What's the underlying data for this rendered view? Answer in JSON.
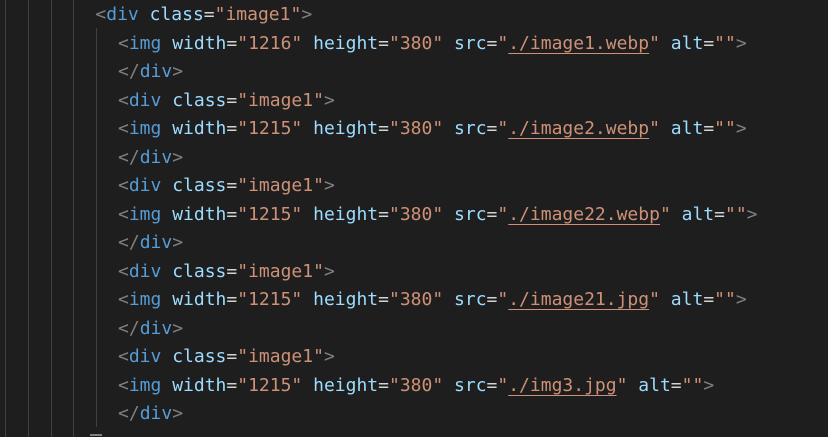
{
  "editor": {
    "lines": [
      {
        "indent": 4,
        "tokens": [
          {
            "t": "<",
            "c": "bracket"
          },
          {
            "t": "div",
            "c": "tag"
          },
          {
            "t": " "
          },
          {
            "t": "class",
            "c": "attr"
          },
          {
            "t": "=",
            "c": "eq"
          },
          {
            "t": "\"image1\"",
            "c": "str"
          },
          {
            "t": ">",
            "c": "bracket"
          }
        ]
      },
      {
        "indent": 5,
        "tokens": [
          {
            "t": "<",
            "c": "bracket"
          },
          {
            "t": "img",
            "c": "tag"
          },
          {
            "t": " "
          },
          {
            "t": "width",
            "c": "attr"
          },
          {
            "t": "=",
            "c": "eq"
          },
          {
            "t": "\"1216\"",
            "c": "str"
          },
          {
            "t": " "
          },
          {
            "t": "height",
            "c": "attr"
          },
          {
            "t": "=",
            "c": "eq"
          },
          {
            "t": "\"380\"",
            "c": "str"
          },
          {
            "t": " "
          },
          {
            "t": "src",
            "c": "attr"
          },
          {
            "t": "=",
            "c": "eq"
          },
          {
            "t": "\"",
            "c": "str"
          },
          {
            "t": "./image1.webp",
            "c": "link"
          },
          {
            "t": "\"",
            "c": "str"
          },
          {
            "t": " "
          },
          {
            "t": "alt",
            "c": "attr"
          },
          {
            "t": "=",
            "c": "eq"
          },
          {
            "t": "\"\"",
            "c": "str"
          },
          {
            "t": ">",
            "c": "bracket"
          }
        ]
      },
      {
        "indent": 5,
        "tokens": [
          {
            "t": "</",
            "c": "bracket"
          },
          {
            "t": "div",
            "c": "tag"
          },
          {
            "t": ">",
            "c": "bracket"
          }
        ]
      },
      {
        "indent": 5,
        "tokens": [
          {
            "t": "<",
            "c": "bracket"
          },
          {
            "t": "div",
            "c": "tag"
          },
          {
            "t": " "
          },
          {
            "t": "class",
            "c": "attr"
          },
          {
            "t": "=",
            "c": "eq"
          },
          {
            "t": "\"image1\"",
            "c": "str"
          },
          {
            "t": ">",
            "c": "bracket"
          }
        ]
      },
      {
        "indent": 5,
        "tokens": [
          {
            "t": "<",
            "c": "bracket"
          },
          {
            "t": "img",
            "c": "tag"
          },
          {
            "t": " "
          },
          {
            "t": "width",
            "c": "attr"
          },
          {
            "t": "=",
            "c": "eq"
          },
          {
            "t": "\"1215\"",
            "c": "str"
          },
          {
            "t": " "
          },
          {
            "t": "height",
            "c": "attr"
          },
          {
            "t": "=",
            "c": "eq"
          },
          {
            "t": "\"380\"",
            "c": "str"
          },
          {
            "t": " "
          },
          {
            "t": "src",
            "c": "attr"
          },
          {
            "t": "=",
            "c": "eq"
          },
          {
            "t": "\"",
            "c": "str"
          },
          {
            "t": "./image2.webp",
            "c": "link"
          },
          {
            "t": "\"",
            "c": "str"
          },
          {
            "t": " "
          },
          {
            "t": "alt",
            "c": "attr"
          },
          {
            "t": "=",
            "c": "eq"
          },
          {
            "t": "\"\"",
            "c": "str"
          },
          {
            "t": ">",
            "c": "bracket"
          }
        ]
      },
      {
        "indent": 5,
        "tokens": [
          {
            "t": "</",
            "c": "bracket"
          },
          {
            "t": "div",
            "c": "tag"
          },
          {
            "t": ">",
            "c": "bracket"
          }
        ]
      },
      {
        "indent": 5,
        "tokens": [
          {
            "t": "<",
            "c": "bracket"
          },
          {
            "t": "div",
            "c": "tag"
          },
          {
            "t": " "
          },
          {
            "t": "class",
            "c": "attr"
          },
          {
            "t": "=",
            "c": "eq"
          },
          {
            "t": "\"image1\"",
            "c": "str"
          },
          {
            "t": ">",
            "c": "bracket"
          }
        ]
      },
      {
        "indent": 5,
        "tokens": [
          {
            "t": "<",
            "c": "bracket"
          },
          {
            "t": "img",
            "c": "tag"
          },
          {
            "t": " "
          },
          {
            "t": "width",
            "c": "attr"
          },
          {
            "t": "=",
            "c": "eq"
          },
          {
            "t": "\"1215\"",
            "c": "str"
          },
          {
            "t": " "
          },
          {
            "t": "height",
            "c": "attr"
          },
          {
            "t": "=",
            "c": "eq"
          },
          {
            "t": "\"380\"",
            "c": "str"
          },
          {
            "t": " "
          },
          {
            "t": "src",
            "c": "attr"
          },
          {
            "t": "=",
            "c": "eq"
          },
          {
            "t": "\"",
            "c": "str"
          },
          {
            "t": "./image22.webp",
            "c": "link"
          },
          {
            "t": "\"",
            "c": "str"
          },
          {
            "t": " "
          },
          {
            "t": "alt",
            "c": "attr"
          },
          {
            "t": "=",
            "c": "eq"
          },
          {
            "t": "\"\"",
            "c": "str"
          },
          {
            "t": ">",
            "c": "bracket"
          }
        ]
      },
      {
        "indent": 5,
        "tokens": [
          {
            "t": "</",
            "c": "bracket"
          },
          {
            "t": "div",
            "c": "tag"
          },
          {
            "t": ">",
            "c": "bracket"
          }
        ]
      },
      {
        "indent": 5,
        "tokens": [
          {
            "t": "<",
            "c": "bracket"
          },
          {
            "t": "div",
            "c": "tag"
          },
          {
            "t": " "
          },
          {
            "t": "class",
            "c": "attr"
          },
          {
            "t": "=",
            "c": "eq"
          },
          {
            "t": "\"image1\"",
            "c": "str"
          },
          {
            "t": ">",
            "c": "bracket"
          }
        ]
      },
      {
        "indent": 5,
        "tokens": [
          {
            "t": "<",
            "c": "bracket"
          },
          {
            "t": "img",
            "c": "tag"
          },
          {
            "t": " "
          },
          {
            "t": "width",
            "c": "attr"
          },
          {
            "t": "=",
            "c": "eq"
          },
          {
            "t": "\"1215\"",
            "c": "str"
          },
          {
            "t": " "
          },
          {
            "t": "height",
            "c": "attr"
          },
          {
            "t": "=",
            "c": "eq"
          },
          {
            "t": "\"380\"",
            "c": "str"
          },
          {
            "t": " "
          },
          {
            "t": "src",
            "c": "attr"
          },
          {
            "t": "=",
            "c": "eq"
          },
          {
            "t": "\"",
            "c": "str"
          },
          {
            "t": "./image21.jpg",
            "c": "link"
          },
          {
            "t": "\"",
            "c": "str"
          },
          {
            "t": " "
          },
          {
            "t": "alt",
            "c": "attr"
          },
          {
            "t": "=",
            "c": "eq"
          },
          {
            "t": "\"\"",
            "c": "str"
          },
          {
            "t": ">",
            "c": "bracket"
          }
        ]
      },
      {
        "indent": 5,
        "tokens": [
          {
            "t": "</",
            "c": "bracket"
          },
          {
            "t": "div",
            "c": "tag"
          },
          {
            "t": ">",
            "c": "bracket"
          }
        ]
      },
      {
        "indent": 5,
        "tokens": [
          {
            "t": "<",
            "c": "bracket"
          },
          {
            "t": "div",
            "c": "tag"
          },
          {
            "t": " "
          },
          {
            "t": "class",
            "c": "attr"
          },
          {
            "t": "=",
            "c": "eq"
          },
          {
            "t": "\"image1\"",
            "c": "str"
          },
          {
            "t": ">",
            "c": "bracket"
          }
        ]
      },
      {
        "indent": 5,
        "tokens": [
          {
            "t": "<",
            "c": "bracket"
          },
          {
            "t": "img",
            "c": "tag"
          },
          {
            "t": " "
          },
          {
            "t": "width",
            "c": "attr"
          },
          {
            "t": "=",
            "c": "eq"
          },
          {
            "t": "\"1215\"",
            "c": "str"
          },
          {
            "t": " "
          },
          {
            "t": "height",
            "c": "attr"
          },
          {
            "t": "=",
            "c": "eq"
          },
          {
            "t": "\"380\"",
            "c": "str"
          },
          {
            "t": " "
          },
          {
            "t": "src",
            "c": "attr"
          },
          {
            "t": "=",
            "c": "eq"
          },
          {
            "t": "\"",
            "c": "str"
          },
          {
            "t": "./img3.jpg",
            "c": "link"
          },
          {
            "t": "\"",
            "c": "str"
          },
          {
            "t": " "
          },
          {
            "t": "alt",
            "c": "attr"
          },
          {
            "t": "=",
            "c": "eq"
          },
          {
            "t": "\"\"",
            "c": "str"
          },
          {
            "t": ">",
            "c": "bracket"
          }
        ]
      },
      {
        "indent": 5,
        "tokens": [
          {
            "t": "</",
            "c": "bracket"
          },
          {
            "t": "div",
            "c": "tag"
          },
          {
            "t": ">",
            "c": "bracket"
          }
        ]
      }
    ],
    "colors": {
      "background": "#1e1e1e",
      "bracket": "#808080",
      "tag": "#569cd6",
      "attr": "#9cdcfe",
      "string": "#ce9178",
      "guide": "#404040"
    }
  }
}
